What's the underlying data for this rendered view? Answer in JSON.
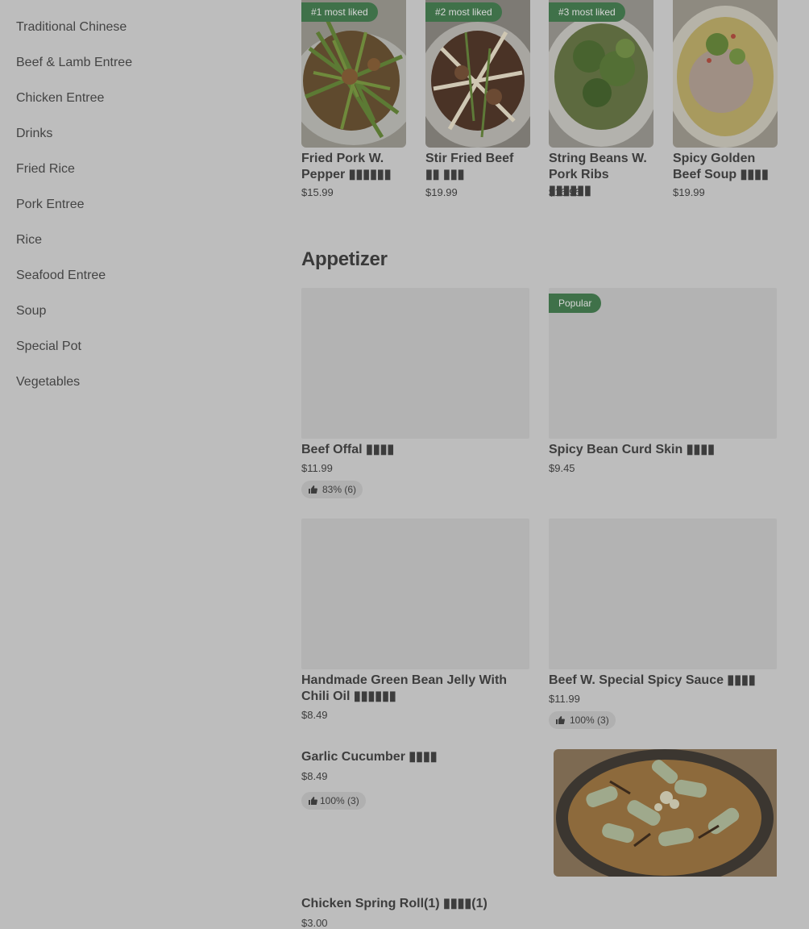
{
  "sidebar": {
    "items": [
      {
        "label": "Traditional Chinese"
      },
      {
        "label": "Beef & Lamb Entree"
      },
      {
        "label": "Chicken Entree"
      },
      {
        "label": "Drinks"
      },
      {
        "label": "Fried Rice"
      },
      {
        "label": "Pork Entree"
      },
      {
        "label": "Rice"
      },
      {
        "label": "Seafood Entree"
      },
      {
        "label": "Soup"
      },
      {
        "label": "Special Pot"
      },
      {
        "label": "Vegetables"
      }
    ]
  },
  "most_liked": [
    {
      "badge": "#1 most liked",
      "name": "Fried Pork W. Pepper ▮▮▮▮▮▮",
      "price": "$15.99"
    },
    {
      "badge": "#2 most liked",
      "name": "Stir Fried Beef ▮▮ ▮▮▮",
      "price": "$19.99"
    },
    {
      "badge": "#3 most liked",
      "name": "String Beans W. Pork Ribs ▮▮▮▮▮▮",
      "price": "$16.95"
    },
    {
      "badge": "",
      "name": "Spicy Golden Beef Soup ▮▮▮▮",
      "price": "$19.99"
    }
  ],
  "appetizer": {
    "title": "Appetizer",
    "items": [
      {
        "name": "Beef Offal ▮▮▮▮",
        "price": "$11.99",
        "rating": "83% (6)",
        "badge": ""
      },
      {
        "name": "Spicy Bean Curd Skin ▮▮▮▮",
        "price": "$9.45",
        "rating": "",
        "badge": "Popular"
      },
      {
        "name": "Handmade Green Bean Jelly With Chili Oil ▮▮▮▮▮▮",
        "price": "$8.49",
        "rating": "",
        "badge": ""
      },
      {
        "name": "Beef W. Special Spicy Sauce ▮▮▮▮",
        "price": "$11.99",
        "rating": "100% (3)",
        "badge": ""
      },
      {
        "name": "Garlic Cucumber ▮▮▮▮",
        "price": "$8.49",
        "rating": "100% (3)",
        "badge": ""
      },
      {
        "name": "Chicken Spring Roll(1) ▮▮▮▮(1)",
        "price": "$3.00",
        "rating": "",
        "badge": ""
      }
    ]
  },
  "icons": {
    "thumb": "thumbs-up-icon"
  },
  "colors": {
    "badge_bg": "#3f7149",
    "overlay_bg": "#bdbdbd"
  }
}
